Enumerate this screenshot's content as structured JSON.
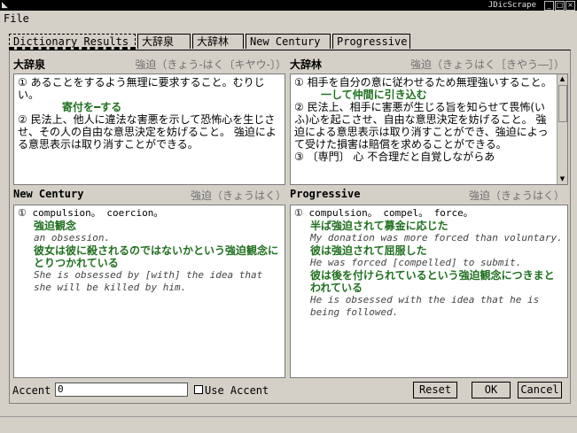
{
  "window": {
    "title": "JDicScrape"
  },
  "menu": {
    "file": "File"
  },
  "tabs": [
    "Dictionary Results",
    "大辞泉",
    "大辞林",
    "New Century",
    "Progressive"
  ],
  "panels": {
    "daijisen": {
      "name": "大辞泉",
      "reading": "強迫（きょう‐はく〔キヤウ‐〕）",
      "def1": "① あることをするよう無理に要求すること。むりじい。",
      "ex1": "寄付を━する",
      "def2": "② 民法上、他人に違法な害悪を示して恐怖心を生じさせ、その人の自由な意思決定を妨げること。 強迫による意思表示は取り消すことができる。"
    },
    "daijirin": {
      "name": "大辞林",
      "reading": "強迫（きょうはく［きやう―］）",
      "def1": "① 相手を自分の意に従わせるため無理強いすること。",
      "ex1": "一して仲間に引き込む",
      "def2": "② 民法上、相手に害悪が生じる旨を知らせて畏怖(いふ)心を起こさせ、自由な意思決定を妨げること。 強迫による意思表示は取り消すことができ、強迫によって受けた損害は賠償を求めることができる。",
      "def3": "③ 〔専門〕 心 不合理だと自覚しながらあ"
    },
    "newcentury": {
      "name": "New Century",
      "reading": "強迫（きょうはく）",
      "sense": "① compulsion。 coercion。",
      "term1": "強迫観念",
      "term1_en": "an obsession.",
      "term2": "彼女は彼に殺されるのではないかという強迫観念にとりつかれている",
      "term2_en": "She is obsessed by [with] the idea that she will be killed by him."
    },
    "progressive": {
      "name": "Progressive",
      "reading": "強迫（きょうはく）",
      "sense": "① compulsion。 compel。 force。",
      "ex1": "半ば強迫されて募金に応じた",
      "ex1_en": "My donation was more forced than voluntary.",
      "ex2": "彼は強迫されて屈服した",
      "ex2_en": "He was forced [compelled] to submit.",
      "ex3": "彼は後を付けられているという強迫観念につきまとわれている",
      "ex3_en": "He is obsessed with the idea that he is being followed."
    }
  },
  "bottom": {
    "accent_label": "Accent",
    "accent_value": "0",
    "use_accent_label": "Use Accent",
    "reset": "Reset",
    "ok": "OK",
    "cancel": "Cancel"
  }
}
